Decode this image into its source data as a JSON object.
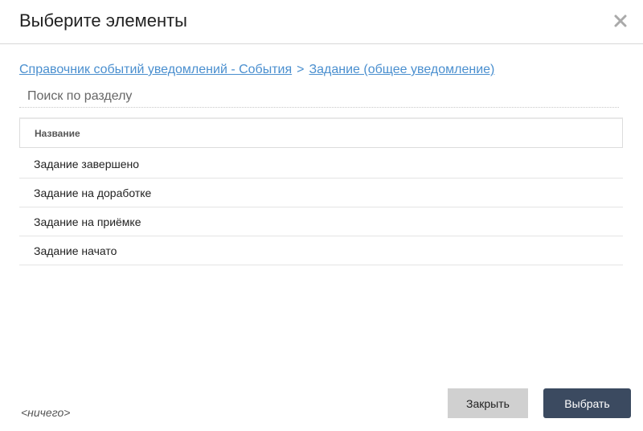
{
  "dialog": {
    "title": "Выберите элементы",
    "close_icon": "close-icon"
  },
  "breadcrumb": {
    "items": [
      {
        "label": "Справочник событий уведомлений - События"
      },
      {
        "label": "Задание (общее уведомление)"
      }
    ],
    "separator": ">"
  },
  "search": {
    "placeholder": "Поиск по разделу",
    "value": ""
  },
  "table": {
    "columns": [
      "Название"
    ],
    "rows": [
      "Задание завершено",
      "Задание на доработке",
      "Задание на приёмке",
      "Задание начато"
    ]
  },
  "footer": {
    "selection_text": "<ничего>",
    "close_label": "Закрыть",
    "select_label": "Выбрать"
  },
  "colors": {
    "link": "#4a8fcf",
    "primary_button": "#3b4a60",
    "secondary_button": "#d0d0d0"
  }
}
